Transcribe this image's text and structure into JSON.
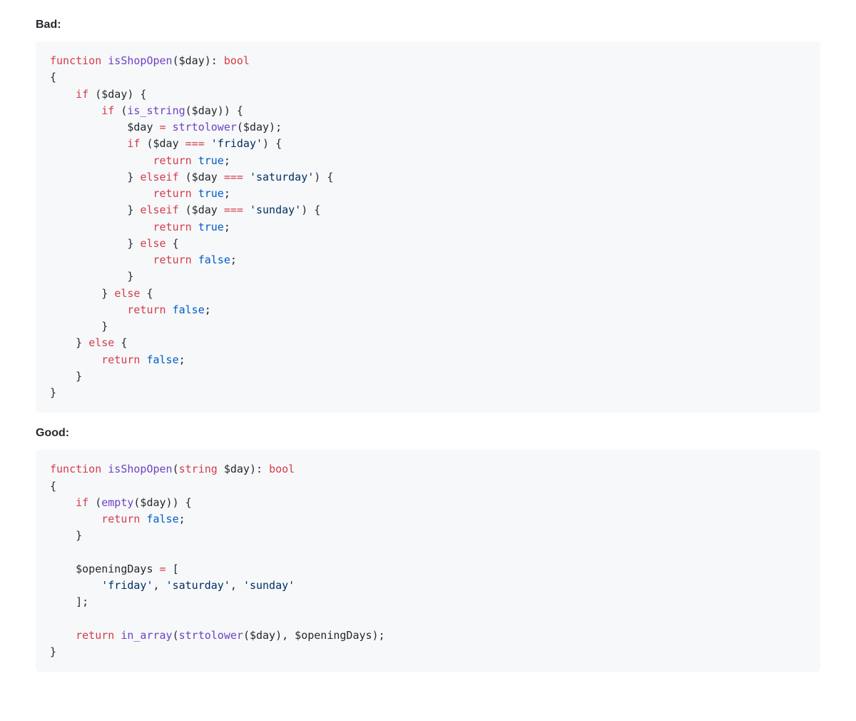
{
  "sections": {
    "bad": {
      "heading": "Bad:",
      "lines": [
        [
          [
            "kw",
            "function"
          ],
          [
            "p",
            " "
          ],
          [
            "fn",
            "isShopOpen"
          ],
          [
            "p",
            "("
          ],
          [
            "p",
            "$day"
          ],
          [
            "p",
            "): "
          ],
          [
            "kw",
            "bool"
          ]
        ],
        [
          [
            "p",
            "{"
          ]
        ],
        [
          [
            "p",
            "    "
          ],
          [
            "kw",
            "if"
          ],
          [
            "p",
            " ($day) {"
          ]
        ],
        [
          [
            "p",
            "        "
          ],
          [
            "kw",
            "if"
          ],
          [
            "p",
            " ("
          ],
          [
            "fn",
            "is_string"
          ],
          [
            "p",
            "($day)) {"
          ]
        ],
        [
          [
            "p",
            "            $day "
          ],
          [
            "op",
            "="
          ],
          [
            "p",
            " "
          ],
          [
            "fn",
            "strtolower"
          ],
          [
            "p",
            "($day);"
          ]
        ],
        [
          [
            "p",
            "            "
          ],
          [
            "kw",
            "if"
          ],
          [
            "p",
            " ($day "
          ],
          [
            "op",
            "==="
          ],
          [
            "p",
            " "
          ],
          [
            "str",
            "'friday'"
          ],
          [
            "p",
            ") {"
          ]
        ],
        [
          [
            "p",
            "                "
          ],
          [
            "kw",
            "return"
          ],
          [
            "p",
            " "
          ],
          [
            "num",
            "true"
          ],
          [
            "p",
            ";"
          ]
        ],
        [
          [
            "p",
            "            } "
          ],
          [
            "kw",
            "elseif"
          ],
          [
            "p",
            " ($day "
          ],
          [
            "op",
            "==="
          ],
          [
            "p",
            " "
          ],
          [
            "str",
            "'saturday'"
          ],
          [
            "p",
            ") {"
          ]
        ],
        [
          [
            "p",
            "                "
          ],
          [
            "kw",
            "return"
          ],
          [
            "p",
            " "
          ],
          [
            "num",
            "true"
          ],
          [
            "p",
            ";"
          ]
        ],
        [
          [
            "p",
            "            } "
          ],
          [
            "kw",
            "elseif"
          ],
          [
            "p",
            " ($day "
          ],
          [
            "op",
            "==="
          ],
          [
            "p",
            " "
          ],
          [
            "str",
            "'sunday'"
          ],
          [
            "p",
            ") {"
          ]
        ],
        [
          [
            "p",
            "                "
          ],
          [
            "kw",
            "return"
          ],
          [
            "p",
            " "
          ],
          [
            "num",
            "true"
          ],
          [
            "p",
            ";"
          ]
        ],
        [
          [
            "p",
            "            } "
          ],
          [
            "kw",
            "else"
          ],
          [
            "p",
            " {"
          ]
        ],
        [
          [
            "p",
            "                "
          ],
          [
            "kw",
            "return"
          ],
          [
            "p",
            " "
          ],
          [
            "num",
            "false"
          ],
          [
            "p",
            ";"
          ]
        ],
        [
          [
            "p",
            "            }"
          ]
        ],
        [
          [
            "p",
            "        } "
          ],
          [
            "kw",
            "else"
          ],
          [
            "p",
            " {"
          ]
        ],
        [
          [
            "p",
            "            "
          ],
          [
            "kw",
            "return"
          ],
          [
            "p",
            " "
          ],
          [
            "num",
            "false"
          ],
          [
            "p",
            ";"
          ]
        ],
        [
          [
            "p",
            "        }"
          ]
        ],
        [
          [
            "p",
            "    } "
          ],
          [
            "kw",
            "else"
          ],
          [
            "p",
            " {"
          ]
        ],
        [
          [
            "p",
            "        "
          ],
          [
            "kw",
            "return"
          ],
          [
            "p",
            " "
          ],
          [
            "num",
            "false"
          ],
          [
            "p",
            ";"
          ]
        ],
        [
          [
            "p",
            "    }"
          ]
        ],
        [
          [
            "p",
            "}"
          ]
        ]
      ]
    },
    "good": {
      "heading": "Good:",
      "lines": [
        [
          [
            "kw",
            "function"
          ],
          [
            "p",
            " "
          ],
          [
            "fn",
            "isShopOpen"
          ],
          [
            "p",
            "("
          ],
          [
            "kw",
            "string"
          ],
          [
            "p",
            " $day): "
          ],
          [
            "kw",
            "bool"
          ]
        ],
        [
          [
            "p",
            "{"
          ]
        ],
        [
          [
            "p",
            "    "
          ],
          [
            "kw",
            "if"
          ],
          [
            "p",
            " ("
          ],
          [
            "fn",
            "empty"
          ],
          [
            "p",
            "($day)) {"
          ]
        ],
        [
          [
            "p",
            "        "
          ],
          [
            "kw",
            "return"
          ],
          [
            "p",
            " "
          ],
          [
            "num",
            "false"
          ],
          [
            "p",
            ";"
          ]
        ],
        [
          [
            "p",
            "    }"
          ]
        ],
        [
          [
            "p",
            ""
          ]
        ],
        [
          [
            "p",
            "    $openingDays "
          ],
          [
            "op",
            "="
          ],
          [
            "p",
            " ["
          ]
        ],
        [
          [
            "p",
            "        "
          ],
          [
            "str",
            "'friday'"
          ],
          [
            "p",
            ", "
          ],
          [
            "str",
            "'saturday'"
          ],
          [
            "p",
            ", "
          ],
          [
            "str",
            "'sunday'"
          ]
        ],
        [
          [
            "p",
            "    ];"
          ]
        ],
        [
          [
            "p",
            ""
          ]
        ],
        [
          [
            "p",
            "    "
          ],
          [
            "kw",
            "return"
          ],
          [
            "p",
            " "
          ],
          [
            "fn",
            "in_array"
          ],
          [
            "p",
            "("
          ],
          [
            "fn",
            "strtolower"
          ],
          [
            "p",
            "($day), $openingDays);"
          ]
        ],
        [
          [
            "p",
            "}"
          ]
        ]
      ]
    }
  }
}
